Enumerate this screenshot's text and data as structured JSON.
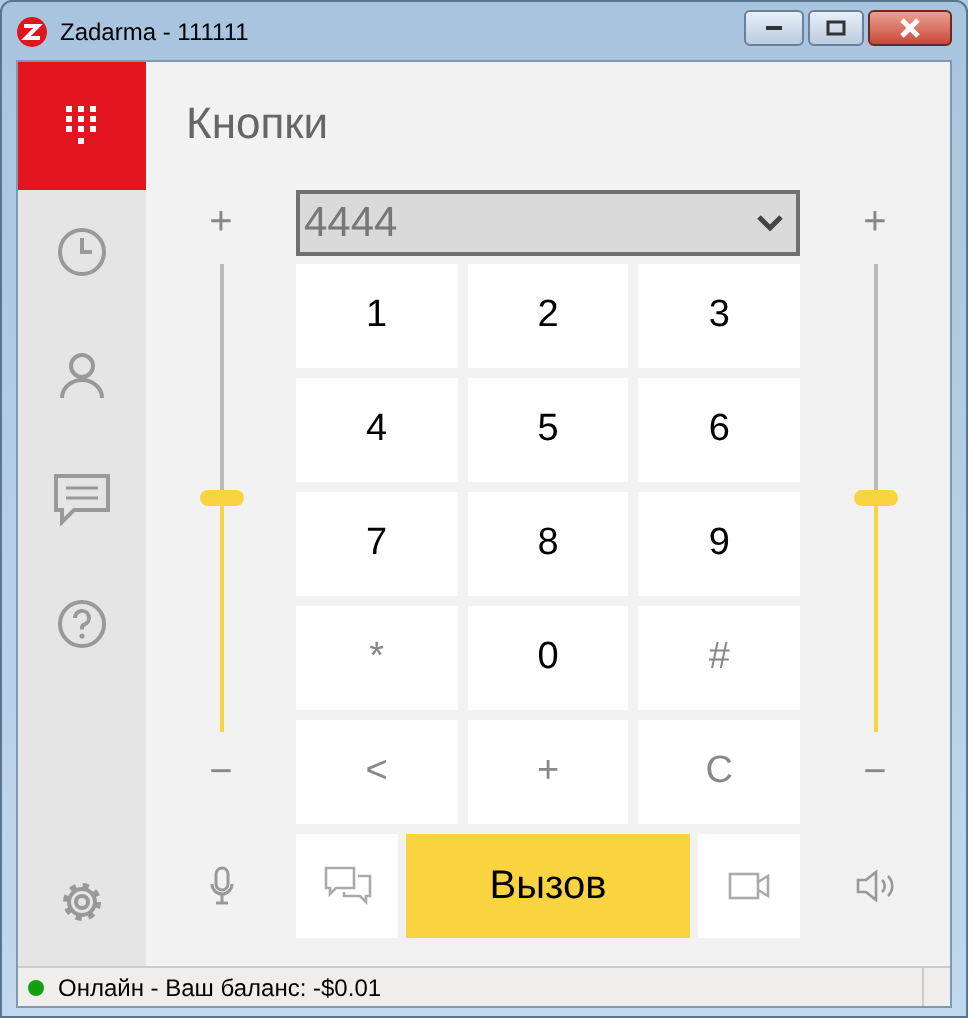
{
  "window": {
    "title": "Zadarma - 111111"
  },
  "sidebar": {
    "items": [
      {
        "kind": "dialpad",
        "selected": true
      },
      {
        "kind": "history",
        "selected": false
      },
      {
        "kind": "contacts",
        "selected": false
      },
      {
        "kind": "chat",
        "selected": false
      },
      {
        "kind": "help",
        "selected": false
      },
      {
        "kind": "settings",
        "selected": false
      }
    ]
  },
  "page_title": "Кнопки",
  "number_field": {
    "value": "4444"
  },
  "sliders": [
    {
      "plus": "+",
      "minus": "−",
      "level": 0.5
    },
    {
      "plus": "+",
      "minus": "−",
      "level": 0.5
    }
  ],
  "keypad": [
    {
      "label": "1",
      "kind": "digit"
    },
    {
      "label": "2",
      "kind": "digit"
    },
    {
      "label": "3",
      "kind": "digit"
    },
    {
      "label": "4",
      "kind": "digit"
    },
    {
      "label": "5",
      "kind": "digit"
    },
    {
      "label": "6",
      "kind": "digit"
    },
    {
      "label": "7",
      "kind": "digit"
    },
    {
      "label": "8",
      "kind": "digit"
    },
    {
      "label": "9",
      "kind": "digit"
    },
    {
      "label": "*",
      "kind": "symbol"
    },
    {
      "label": "0",
      "kind": "digit"
    },
    {
      "label": "#",
      "kind": "symbol"
    },
    {
      "label": "<",
      "kind": "symbol"
    },
    {
      "label": "+",
      "kind": "symbol"
    },
    {
      "label": "C",
      "kind": "symbol"
    }
  ],
  "call_button": "Вызов",
  "status_bar": {
    "text": "Онлайн - Ваш баланс: -$0.01",
    "color": "#13a010"
  }
}
